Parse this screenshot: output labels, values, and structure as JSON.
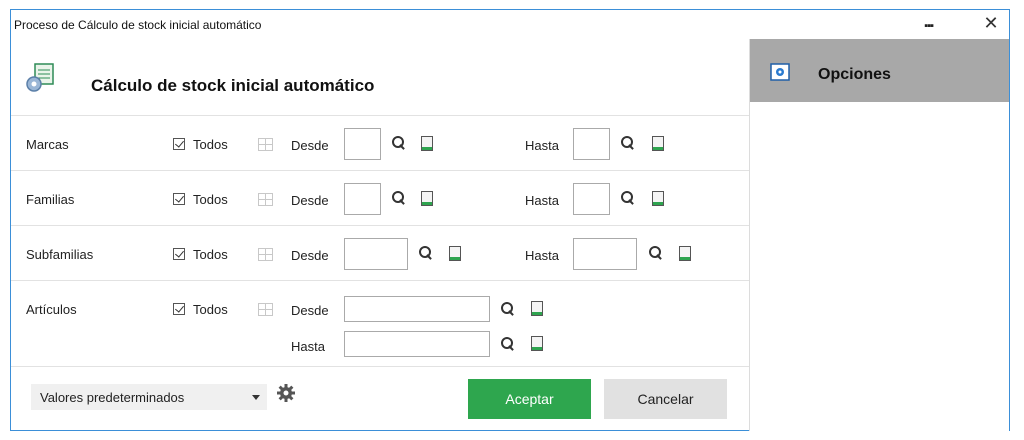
{
  "window": {
    "title": "Proceso de Cálculo de stock inicial automático",
    "more_label": "▪▪▪",
    "close_label": "✕"
  },
  "header": {
    "title": "Cálculo de stock inicial automático"
  },
  "rows": [
    {
      "label": "Marcas",
      "todos": "Todos",
      "desde": "Desde",
      "hasta": "Hasta"
    },
    {
      "label": "Familias",
      "todos": "Todos",
      "desde": "Desde",
      "hasta": "Hasta"
    },
    {
      "label": "Subfamilias",
      "todos": "Todos",
      "desde": "Desde",
      "hasta": "Hasta"
    },
    {
      "label": "Artículos",
      "todos": "Todos",
      "desde": "Desde",
      "hasta": "Hasta"
    }
  ],
  "footer": {
    "preset_value": "Valores predeterminados",
    "accept_label": "Aceptar",
    "cancel_label": "Cancelar"
  },
  "side": {
    "title": "Opciones"
  },
  "colors": {
    "accent": "#2ea64e",
    "side_header": "#a8a8a8",
    "window_border": "#3b8fd8"
  }
}
